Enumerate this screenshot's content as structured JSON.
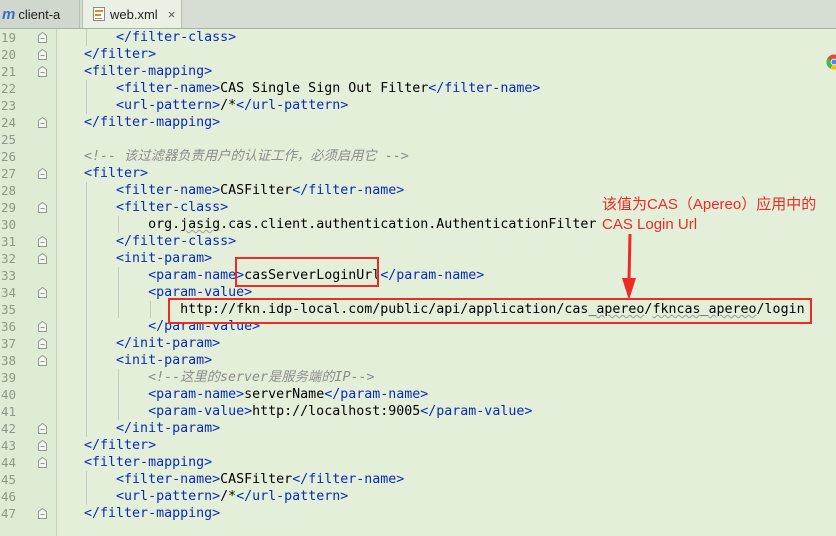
{
  "tabs": [
    {
      "label": "client-a",
      "icon": "m-module-icon",
      "active": false
    },
    {
      "label": "web.xml",
      "icon": "xml-file-icon",
      "active": true,
      "close": "×"
    }
  ],
  "annotation": {
    "line1": "该值为CAS（Apereo）应用中的",
    "line2": "CAS Login Url",
    "color": "#ee2a24"
  },
  "lines": [
    {
      "n": "19",
      "t": [
        {
          "c": "tag",
          "s": "        </filter-class>"
        }
      ]
    },
    {
      "n": "20",
      "t": [
        {
          "c": "tag",
          "s": "    </filter>"
        }
      ]
    },
    {
      "n": "21",
      "t": [
        {
          "c": "tag",
          "s": "    <filter-mapping>"
        }
      ]
    },
    {
      "n": "22",
      "t": [
        {
          "c": "tag",
          "s": "        <filter-name>"
        },
        {
          "c": "",
          "s": "CAS Single Sign Out Filter"
        },
        {
          "c": "tag",
          "s": "</filter-name>"
        }
      ]
    },
    {
      "n": "23",
      "t": [
        {
          "c": "tag",
          "s": "        <url-pattern>"
        },
        {
          "c": "",
          "s": "/*"
        },
        {
          "c": "tag",
          "s": "</url-pattern>"
        }
      ]
    },
    {
      "n": "24",
      "t": [
        {
          "c": "tag",
          "s": "    </filter-mapping>"
        }
      ]
    },
    {
      "n": "25",
      "t": []
    },
    {
      "n": "26",
      "t": [
        {
          "c": "cmt",
          "s": "    <!-- 该过滤器负责用户的认证工作，必须启用它 -->"
        }
      ]
    },
    {
      "n": "27",
      "t": [
        {
          "c": "tag",
          "s": "    <filter>"
        }
      ]
    },
    {
      "n": "28",
      "t": [
        {
          "c": "tag",
          "s": "        <filter-name>"
        },
        {
          "c": "",
          "s": "CASFilter"
        },
        {
          "c": "tag",
          "s": "</filter-name>"
        }
      ]
    },
    {
      "n": "29",
      "t": [
        {
          "c": "tag",
          "s": "        <filter-class>"
        }
      ]
    },
    {
      "n": "30",
      "t": [
        {
          "c": "",
          "s": "            org."
        },
        {
          "c": "sq",
          "s": "jasig"
        },
        {
          "c": "",
          "s": ".cas.client.authentication.AuthenticationFilter"
        }
      ]
    },
    {
      "n": "31",
      "t": [
        {
          "c": "tag",
          "s": "        </filter-class>"
        }
      ]
    },
    {
      "n": "32",
      "t": [
        {
          "c": "tag",
          "s": "        <init-param>"
        }
      ]
    },
    {
      "n": "33",
      "t": [
        {
          "c": "tag",
          "s": "            <param-name>"
        },
        {
          "c": "",
          "s": "casServerLoginUrl"
        },
        {
          "c": "tag",
          "s": "</param-name>"
        }
      ]
    },
    {
      "n": "34",
      "t": [
        {
          "c": "tag",
          "s": "            <param-value>"
        }
      ]
    },
    {
      "n": "35",
      "t": [
        {
          "c": "",
          "s": "                http://fkn.idp-local.com/public/api/application/cas_"
        },
        {
          "c": "sq",
          "s": "apereo"
        },
        {
          "c": "",
          "s": "/"
        },
        {
          "c": "sq",
          "s": "fkncas"
        },
        {
          "c": "",
          "s": "_"
        },
        {
          "c": "sq",
          "s": "apereo"
        },
        {
          "c": "",
          "s": "/login"
        }
      ]
    },
    {
      "n": "36",
      "t": [
        {
          "c": "tag",
          "s": "            </param-value>"
        }
      ]
    },
    {
      "n": "37",
      "t": [
        {
          "c": "tag",
          "s": "        </init-param>"
        }
      ]
    },
    {
      "n": "38",
      "t": [
        {
          "c": "tag",
          "s": "        <init-param>"
        }
      ]
    },
    {
      "n": "39",
      "t": [
        {
          "c": "cmt",
          "s": "            <!--这里的server是服务端的IP-->"
        }
      ]
    },
    {
      "n": "40",
      "t": [
        {
          "c": "tag",
          "s": "            <param-name>"
        },
        {
          "c": "",
          "s": "serverName"
        },
        {
          "c": "tag",
          "s": "</param-name>"
        }
      ]
    },
    {
      "n": "41",
      "t": [
        {
          "c": "tag",
          "s": "            <param-value>"
        },
        {
          "c": "",
          "s": "http://localhost:9005"
        },
        {
          "c": "tag",
          "s": "</param-value>"
        }
      ]
    },
    {
      "n": "42",
      "t": [
        {
          "c": "tag",
          "s": "        </init-param>"
        }
      ]
    },
    {
      "n": "43",
      "t": [
        {
          "c": "tag",
          "s": "    </filter>"
        }
      ]
    },
    {
      "n": "44",
      "t": [
        {
          "c": "tag",
          "s": "    <filter-mapping>"
        }
      ]
    },
    {
      "n": "45",
      "t": [
        {
          "c": "tag",
          "s": "        <filter-name>"
        },
        {
          "c": "",
          "s": "CASFilter"
        },
        {
          "c": "tag",
          "s": "</filter-name>"
        }
      ]
    },
    {
      "n": "46",
      "t": [
        {
          "c": "tag",
          "s": "        <url-pattern>"
        },
        {
          "c": "",
          "s": "/*"
        },
        {
          "c": "tag",
          "s": "</url-pattern>"
        }
      ]
    },
    {
      "n": "47",
      "t": [
        {
          "c": "tag",
          "s": "    </filter-mapping>"
        }
      ]
    }
  ]
}
